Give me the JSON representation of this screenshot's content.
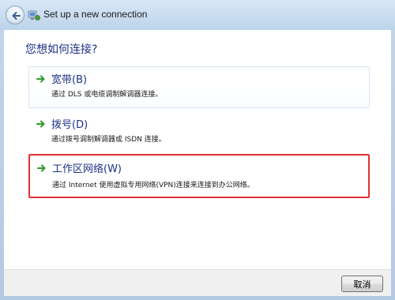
{
  "window": {
    "title": "Set up a new connection"
  },
  "main": {
    "question": "您想如何连接?",
    "options": [
      {
        "label": "宽带(B)",
        "description": "通过 DLS 或电缆调制解调器连接。",
        "selected": false
      },
      {
        "label": "拨号(D)",
        "description": "通过拨号调制解调器或 ISDN 连接。",
        "selected": false
      },
      {
        "label": "工作区网络(W)",
        "description": "通过 Internet 使用虚拟专用网络(VPN)连接来连接到办公网络。",
        "selected": true
      }
    ]
  },
  "footer": {
    "cancel_label": "取消"
  },
  "icons": {
    "back": "back-arrow-icon",
    "wizard": "network-wizard-icon",
    "option_arrow": "green-arrow-icon"
  },
  "colors": {
    "heading": "#1e3287",
    "arrow_green": "#2e9b2e",
    "highlight_red": "#e03030"
  }
}
